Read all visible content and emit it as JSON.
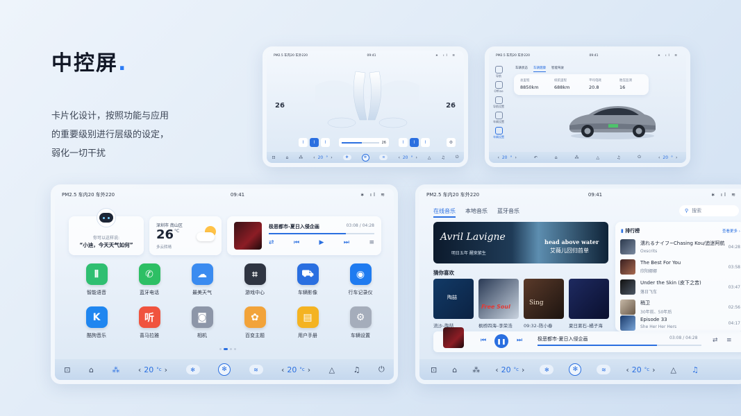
{
  "intro": {
    "title": "中控屏",
    "title_dot": ".",
    "desc_lines": [
      "卡片化设计，按照功能与应用",
      "的重要级别进行层级的设定，",
      "弱化一切干扰"
    ]
  },
  "status_bar": {
    "left": "PM2.5 车内20 车外220",
    "time": "09:41",
    "small_left": "PM2.5 车内20 车外220"
  },
  "dock": {
    "temp_left": "20",
    "temp_right": "20",
    "temp_unit": "°c",
    "temp_unit_small": "°",
    "lt": "‹",
    "gt": "›"
  },
  "climate_screen": {
    "left_temp": "26",
    "right_temp": "26",
    "fan_level": "26"
  },
  "vehicle_screen": {
    "side_items": [
      "导航",
      "Offline",
      "导航设置",
      "车辆设置",
      "车辆设置"
    ],
    "tabs": [
      "车辆状态",
      "车辆健康",
      "智能驾驶"
    ],
    "stats": [
      {
        "label": "总里程",
        "value": "8850km"
      },
      {
        "label": "续航里程",
        "value": "688km"
      },
      {
        "label": "平均电耗",
        "value": "20.8"
      },
      {
        "label": "胎压监测",
        "value": "16"
      }
    ],
    "plate_text": ""
  },
  "home_screen": {
    "assistant_hint": "你可以这样说:",
    "assistant_phrase": "“小迪，今天天气如何”",
    "weather_city": "深圳市 南山区",
    "weather_temp": "26",
    "weather_unit": "°C",
    "weather_desc": "多云转晴",
    "music_title": "极恶都市-夏日入侵企画",
    "music_time": "03:08 / 04:28",
    "music_progress": 0.73,
    "apps": [
      {
        "label": "智能语音",
        "icon": "voice-icon",
        "color": "#2fbf71"
      },
      {
        "label": "蓝牙电话",
        "icon": "phone-icon",
        "color": "#2dbf64"
      },
      {
        "label": "最美天气",
        "icon": "weather-icon",
        "color": "#3a8bf0"
      },
      {
        "label": "游戏中心",
        "icon": "gamepad-icon",
        "color": "#2f3542"
      },
      {
        "label": "车辆影像",
        "icon": "car-camera-icon",
        "color": "#2a6fe0"
      },
      {
        "label": "行车记录仪",
        "icon": "dashcam-icon",
        "color": "#1f7bf0"
      },
      {
        "label": "酷狗音乐",
        "icon": "kugou-icon",
        "color": "#1f86f0"
      },
      {
        "label": "喜马拉雅",
        "icon": "ximalaya-icon",
        "color": "#f0533e"
      },
      {
        "label": "相机",
        "icon": "camera-icon",
        "color": "#8d96a8"
      },
      {
        "label": "百变主题",
        "icon": "theme-icon",
        "color": "#f2a33a"
      },
      {
        "label": "用户手册",
        "icon": "manual-icon",
        "color": "#f4b322"
      },
      {
        "label": "车辆设置",
        "icon": "settings-icon",
        "color": "#a5adbb"
      }
    ],
    "apps_glyphs": [
      "⦀",
      "✆",
      "☁",
      "⌗",
      "⛟",
      "◉",
      "K",
      "听",
      "◙",
      "✿",
      "▤",
      "⚙"
    ]
  },
  "music_screen": {
    "tabs": [
      "在线音乐",
      "本地音乐",
      "蓝牙音乐"
    ],
    "search_placeholder": "搜索",
    "banner_left": "Avril Lavigne",
    "banner_left_sub": "明日五年  醒來紫生",
    "banner_right": "head above water",
    "banner_right_sub": "艾薇儿回归首单",
    "fav_title": "猜你喜欢",
    "favorites": [
      "流沙–陶喆",
      "枫桥四海–李荣浩",
      "09:32–陈小春",
      "夏日漱石–橘子海"
    ],
    "fav_cover_text": [
      "陶喆",
      "Free Soul",
      "Sing",
      ""
    ],
    "rank_title": "排行榜",
    "rank_more": "查看更多 ›",
    "rank": [
      {
        "title": "濡れるナイフ~Chasing Kou/追迷阿航",
        "artist": "Oxscrits",
        "time": "04:28"
      },
      {
        "title": "The Best For You",
        "artist": "欣阳娜娜",
        "time": "03:58"
      },
      {
        "title": "Under the Skin (皮下之苦)",
        "artist": "落日飞车",
        "time": "03:47"
      },
      {
        "title": "稍卫",
        "artist": "30年前、50年后",
        "time": "02:56"
      },
      {
        "title": "Episode 33",
        "artist": "She Her Her Hers",
        "time": "04:17"
      }
    ],
    "player_title": "极恶都市-夏日入侵企画",
    "player_time": "03:08 / 04:28",
    "player_progress": 0.73
  },
  "colors": {
    "accent": "#2a6fe0",
    "title_dot": "#2a7bf5"
  }
}
